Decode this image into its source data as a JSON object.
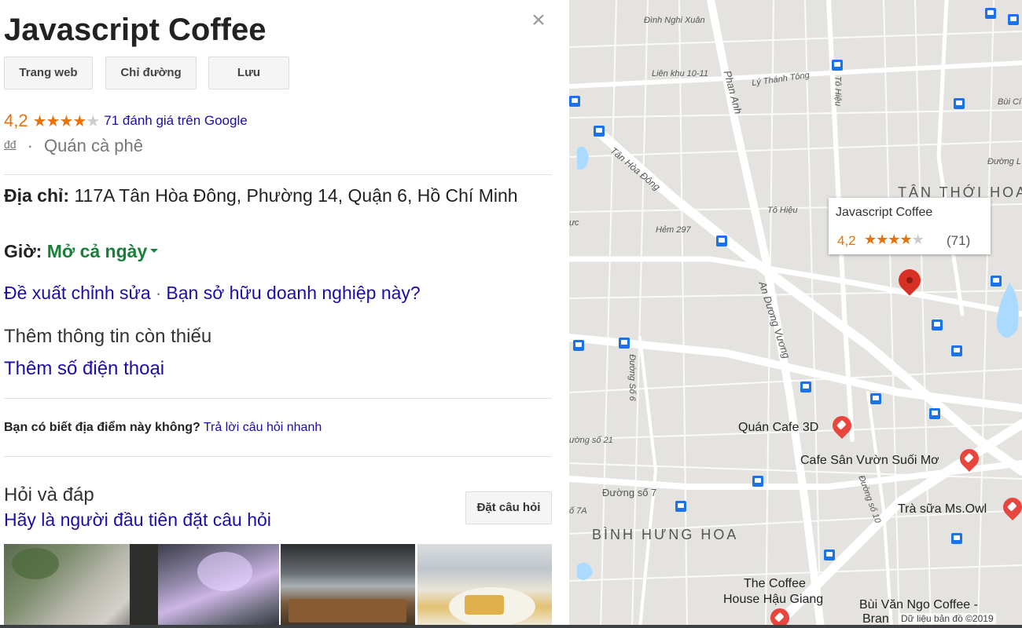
{
  "place": {
    "name": "Javascript Coffee",
    "close_symbol": "×",
    "buttons": {
      "website": "Trang web",
      "directions": "Chỉ đường",
      "save": "Lưu"
    },
    "rating": "4,2",
    "rating_value": 4.2,
    "reviews_link": "71 đánh giá trên Google",
    "price_level": "đđ",
    "type_sep": "·",
    "type": "Quán cà phê",
    "address_label": "Địa chỉ:",
    "address": "117A Tân Hòa Đông, Phường 14, Quận 6, Hồ Chí Minh",
    "hours_label": "Giờ:",
    "hours_value": "Mở cả ngày",
    "suggest_edit": "Đề xuất chỉnh sửa",
    "suggest_sep": "·",
    "own_business": "Bạn sở hữu doanh nghiệp này?",
    "missing_info_heading": "Thêm thông tin còn thiếu",
    "add_phone": "Thêm số điện thoại",
    "know_question": "Bạn có biết địa điểm này không?",
    "know_answer_link": "Trả lời câu hỏi nhanh",
    "qa_heading": "Hỏi và đáp",
    "qa_sub": "Hãy là người đầu tiên đặt câu hỏi",
    "ask_button": "Đặt câu hỏi"
  },
  "map": {
    "infocard": {
      "name": "Javascript Coffee",
      "rating": "4,2",
      "count": "(71)"
    },
    "district_labels": [
      "TÂN THỚI HOA",
      "BÌNH HƯNG HOA"
    ],
    "street_labels": [
      "Đình Nghi Xuân",
      "Liên khu 10-11",
      "Lý Thánh Tông",
      "Phan Anh",
      "Tô Hiệu",
      "Tân Hòa Đông",
      "Tô Hiệu",
      "Hẻm 297",
      "An Dương Vương",
      "Đường Số 6",
      "ường số 21",
      "Đường số 7",
      "ố 7A",
      "Đường số 10",
      "Bùi Cí",
      "Đường L",
      "ực"
    ],
    "pois": [
      "Quán Cafe 3D",
      "Cafe Sân Vườn Suối Mơ",
      "Trà sữa Ms.Owl",
      "The Coffee",
      "House Hậu Giang",
      "Bùi Văn Ngo Coffee -",
      "Bran"
    ],
    "attribution": "Dữ liệu bản đồ ©2019"
  }
}
